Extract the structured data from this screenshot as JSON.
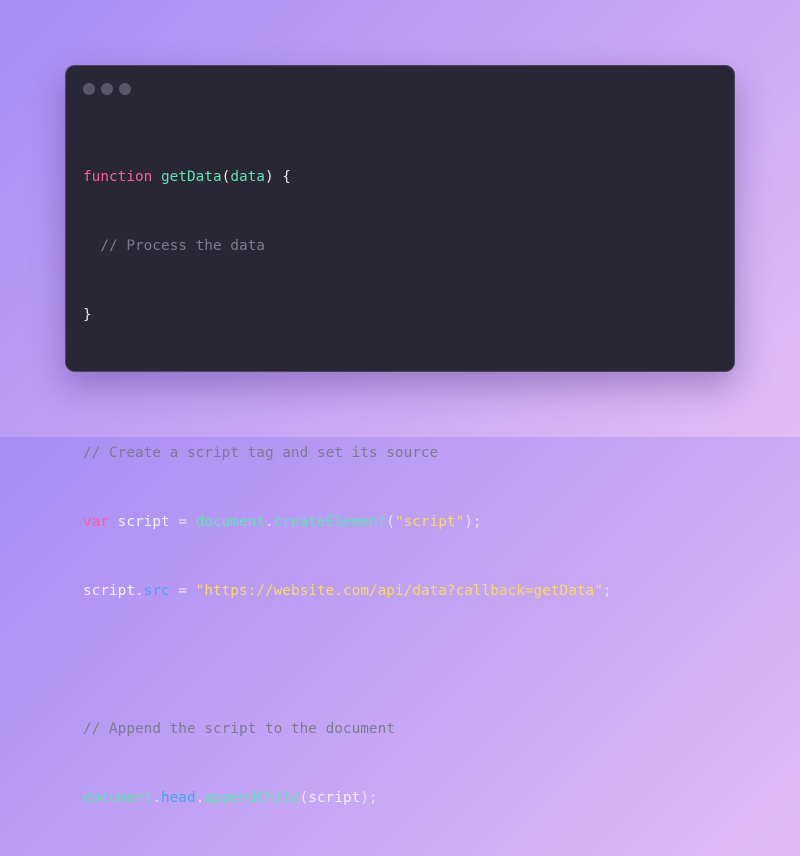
{
  "window": {
    "dot_color": "#5a566a"
  },
  "code": {
    "l1_kw": "function",
    "l1_fn": "getData",
    "l1_open": "(",
    "l1_param": "data",
    "l1_close": ") {",
    "l2": "  // Process the data",
    "l3": "}",
    "l5": "// Create a script tag and set its source",
    "l6_kw": "var",
    "l6_var": " script ",
    "l6_eq": "= ",
    "l6_obj": "document",
    "l6_dot": ".",
    "l6_fn": "createElement",
    "l6_open": "(",
    "l6_str": "\"script\"",
    "l6_close": ");",
    "l7_var": "script",
    "l7_dot": ".",
    "l7_prop": "src",
    "l7_eq": " = ",
    "l7_str": "\"https://website.com/api/data?callback=getData\"",
    "l7_end": ";",
    "l9": "// Append the script to the document",
    "l10_obj": "document",
    "l10_dot1": ".",
    "l10_prop": "head",
    "l10_dot2": ".",
    "l10_fn": "appendChild",
    "l10_open": "(",
    "l10_arg": "script",
    "l10_close": ");"
  },
  "colors": {
    "keyword": "#f7609d",
    "function": "#5fe3b3",
    "comment": "#7e7a92",
    "string": "#f8d969",
    "property": "#3fa9f0",
    "background": "#292636"
  }
}
